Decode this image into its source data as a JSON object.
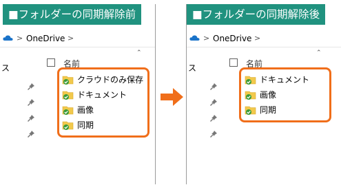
{
  "left": {
    "header": "■フォルダーの同期解除前",
    "breadcrumb": "OneDrive",
    "breadcrumb_sep": ">",
    "nav_partial": "ス",
    "column_name": "名前",
    "files": [
      {
        "name": "クラウドのみ保存",
        "status": "synced"
      },
      {
        "name": "ドキュメント",
        "status": "synced"
      },
      {
        "name": "画像",
        "status": "synced"
      },
      {
        "name": "同期",
        "status": "synced"
      }
    ]
  },
  "right": {
    "header": "■フォルダーの同期解除後",
    "breadcrumb": "OneDrive",
    "breadcrumb_sep": ">",
    "nav_partial": "ス",
    "column_name": "名前",
    "files": [
      {
        "name": "ドキュメント",
        "status": "synced"
      },
      {
        "name": "画像",
        "status": "synced"
      },
      {
        "name": "同期",
        "status": "synced"
      }
    ]
  },
  "colors": {
    "header_bg": "#20927f",
    "highlight": "#f06e1a",
    "arrow": "#f06e1a",
    "folder": "#f2c94c",
    "sync_check": "#3a9b3a",
    "cloud": "#1a73c9"
  }
}
